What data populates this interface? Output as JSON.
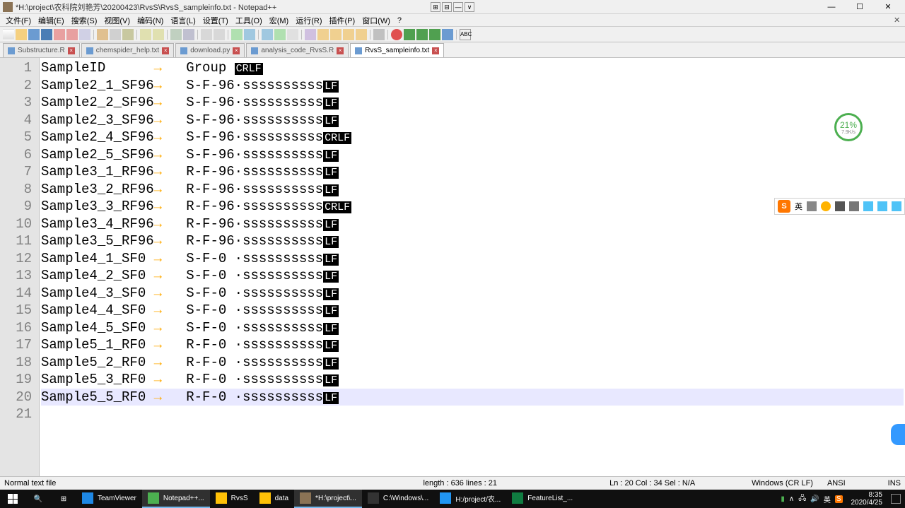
{
  "title": "*H:\\project\\农科院刘艳芳\\20200423\\RvsS\\RvsS_sampleinfo.txt - Notepad++",
  "menus": [
    "文件(F)",
    "编辑(E)",
    "搜索(S)",
    "视图(V)",
    "编码(N)",
    "语言(L)",
    "设置(T)",
    "工具(O)",
    "宏(M)",
    "运行(R)",
    "插件(P)",
    "窗口(W)",
    "?"
  ],
  "tabs": [
    {
      "label": "Substructure.R",
      "active": false,
      "close": true
    },
    {
      "label": "chemspider_help.txt",
      "active": false,
      "close": true
    },
    {
      "label": "download.py",
      "active": false,
      "close": true
    },
    {
      "label": "analysis_code_RvsS.R",
      "active": false,
      "close": true
    },
    {
      "label": "RvsS_sampleinfo.txt",
      "active": true,
      "close": true
    }
  ],
  "lines": [
    {
      "n": 1,
      "c1": "SampleID",
      "c2": "",
      "c3": "Group",
      "eol": "CRLF",
      "ss": ""
    },
    {
      "n": 2,
      "c1": "Sample2_1_SF96",
      "c2": "",
      "c3": "S-F-96",
      "eol": "LF",
      "ss": "ssssssssss"
    },
    {
      "n": 3,
      "c1": "Sample2_2_SF96",
      "c2": "",
      "c3": "S-F-96",
      "eol": "LF",
      "ss": "ssssssssss"
    },
    {
      "n": 4,
      "c1": "Sample2_3_SF96",
      "c2": "",
      "c3": "S-F-96",
      "eol": "LF",
      "ss": "ssssssssss"
    },
    {
      "n": 5,
      "c1": "Sample2_4_SF96",
      "c2": "",
      "c3": "S-F-96",
      "eol": "CRLF",
      "ss": "ssssssssss"
    },
    {
      "n": 6,
      "c1": "Sample2_5_SF96",
      "c2": "",
      "c3": "S-F-96",
      "eol": "LF",
      "ss": "ssssssssss"
    },
    {
      "n": 7,
      "c1": "Sample3_1_RF96",
      "c2": "",
      "c3": "R-F-96",
      "eol": "LF",
      "ss": "ssssssssss"
    },
    {
      "n": 8,
      "c1": "Sample3_2_RF96",
      "c2": "",
      "c3": "R-F-96",
      "eol": "LF",
      "ss": "ssssssssss"
    },
    {
      "n": 9,
      "c1": "Sample3_3_RF96",
      "c2": "",
      "c3": "R-F-96",
      "eol": "CRLF",
      "ss": "ssssssssss"
    },
    {
      "n": 10,
      "c1": "Sample3_4_RF96",
      "c2": "",
      "c3": "R-F-96",
      "eol": "LF",
      "ss": "ssssssssss"
    },
    {
      "n": 11,
      "c1": "Sample3_5_RF96",
      "c2": "",
      "c3": "R-F-96",
      "eol": "LF",
      "ss": "ssssssssss"
    },
    {
      "n": 12,
      "c1": "Sample4_1_SF0",
      "c2": "",
      "c3": "S-F-0",
      "eol": "LF",
      "ss": "ssssssssss"
    },
    {
      "n": 13,
      "c1": "Sample4_2_SF0",
      "c2": "",
      "c3": "S-F-0",
      "eol": "LF",
      "ss": "ssssssssss"
    },
    {
      "n": 14,
      "c1": "Sample4_3_SF0",
      "c2": "",
      "c3": "S-F-0",
      "eol": "LF",
      "ss": "ssssssssss"
    },
    {
      "n": 15,
      "c1": "Sample4_4_SF0",
      "c2": "",
      "c3": "S-F-0",
      "eol": "LF",
      "ss": "ssssssssss"
    },
    {
      "n": 16,
      "c1": "Sample4_5_SF0",
      "c2": "",
      "c3": "S-F-0",
      "eol": "LF",
      "ss": "ssssssssss"
    },
    {
      "n": 17,
      "c1": "Sample5_1_RF0",
      "c2": "",
      "c3": "R-F-0",
      "eol": "LF",
      "ss": "ssssssssss"
    },
    {
      "n": 18,
      "c1": "Sample5_2_RF0",
      "c2": "",
      "c3": "R-F-0",
      "eol": "LF",
      "ss": "ssssssssss"
    },
    {
      "n": 19,
      "c1": "Sample5_3_RF0",
      "c2": "",
      "c3": "R-F-0",
      "eol": "LF",
      "ss": "ssssssssss"
    },
    {
      "n": 20,
      "c1": "Sample5_5_RF0",
      "c2": "",
      "c3": "R-F-0",
      "eol": "LF",
      "ss": "ssssssssss",
      "current": true
    },
    {
      "n": 21,
      "c1": "",
      "c2": "",
      "c3": "",
      "eol": "",
      "ss": ""
    }
  ],
  "badge": {
    "pct": "21%",
    "rate": "7.9K/s"
  },
  "ime": {
    "logo": "S",
    "lang": "英"
  },
  "status": {
    "type": "Normal text file",
    "length": "length : 636    lines : 21",
    "pos": "Ln : 20    Col : 34    Sel : N/A",
    "eol": "Windows (CR LF)",
    "enc": "ANSI",
    "ins": "INS"
  },
  "taskbar": {
    "items": [
      {
        "label": "TeamViewer",
        "color": "#1e88e5"
      },
      {
        "label": "Notepad++...",
        "color": "#4caf50",
        "active": true
      },
      {
        "label": "RvsS",
        "color": "#ffc107"
      },
      {
        "label": "data",
        "color": "#ffc107"
      },
      {
        "label": "*H:\\project\\...",
        "color": "#8b7355",
        "active": true
      },
      {
        "label": "C:\\Windows\\...",
        "color": "#333"
      },
      {
        "label": "H:/project/农...",
        "color": "#2196f3"
      },
      {
        "label": "FeatureList_...",
        "color": "#107c41"
      }
    ],
    "clock": {
      "time": "8:35",
      "date": "2020/4/25"
    }
  }
}
